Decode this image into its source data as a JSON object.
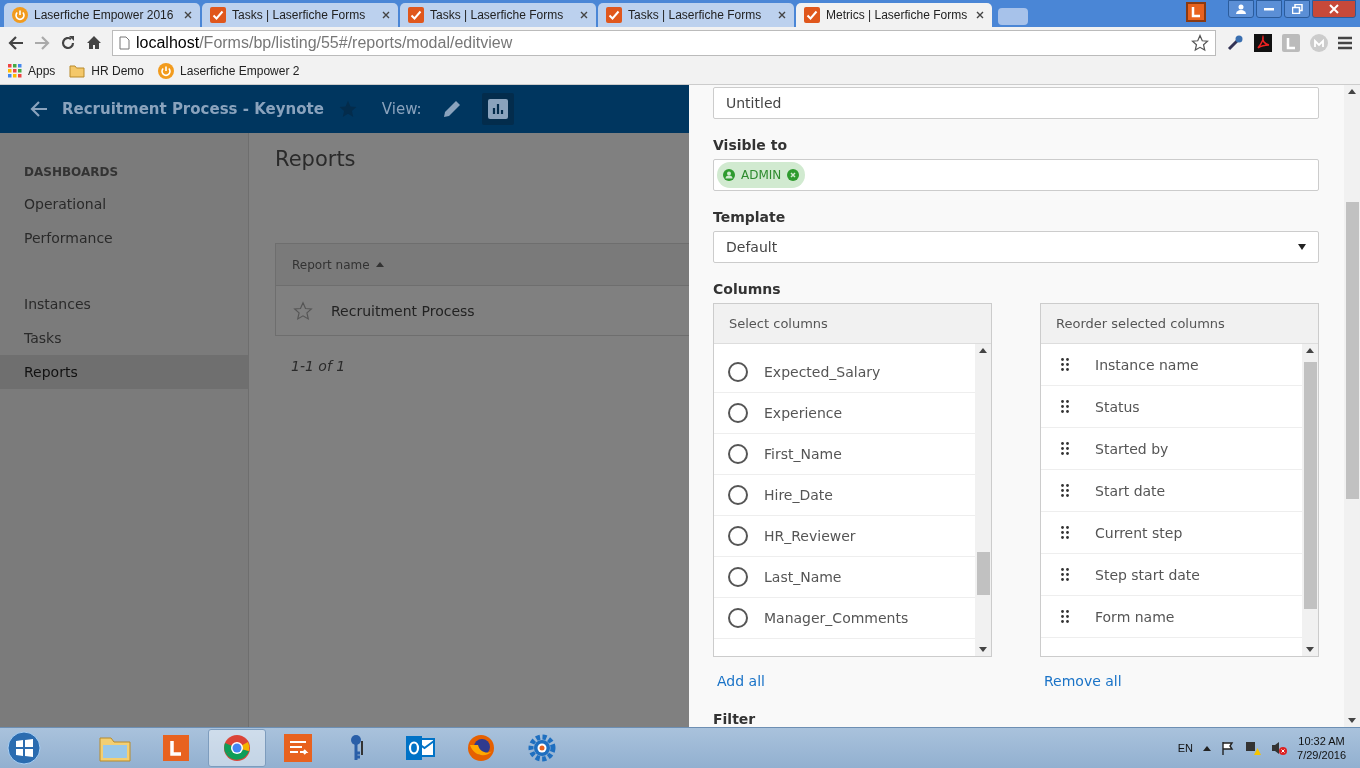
{
  "browser": {
    "tabs": [
      {
        "title": "Laserfiche Empower 2016",
        "kind": "power",
        "selected": false
      },
      {
        "title": "Tasks | Laserfiche Forms",
        "kind": "check",
        "selected": false
      },
      {
        "title": "Tasks | Laserfiche Forms",
        "kind": "check",
        "selected": false
      },
      {
        "title": "Tasks | Laserfiche Forms",
        "kind": "check",
        "selected": false
      },
      {
        "title": "Metrics | Laserfiche Forms",
        "kind": "check",
        "selected": true
      }
    ],
    "url": {
      "host": "localhost",
      "path": "/Forms/bp/listing/55#/reports/modal/editview"
    },
    "bookmarks": [
      {
        "label": "Apps",
        "kind": "apps"
      },
      {
        "label": "HR Demo",
        "kind": "folder"
      },
      {
        "label": "Laserfiche Empower 2",
        "kind": "power"
      }
    ]
  },
  "header": {
    "title": "Recruitment Process - Keynote",
    "view_label": "View:",
    "views": [
      {
        "kind": "edit",
        "selected": false
      },
      {
        "kind": "chart",
        "selected": true
      }
    ]
  },
  "sidebar": {
    "heading": "DASHBOARDS",
    "dashboards": [
      {
        "label": "Operational",
        "selected": false
      },
      {
        "label": "Performance",
        "selected": false
      }
    ],
    "items": [
      {
        "label": "Instances",
        "selected": false
      },
      {
        "label": "Tasks",
        "selected": false
      },
      {
        "label": "Reports",
        "selected": true
      }
    ]
  },
  "main": {
    "title": "Reports",
    "table": {
      "columns": [
        {
          "label": "Report name",
          "sorted_ascending": true
        }
      ],
      "rows": [
        {
          "name": "Recruitment Process",
          "starred": false
        }
      ]
    },
    "pagination": "1-1 of 1"
  },
  "modal": {
    "name_value": "Untitled",
    "visible_label": "Visible to",
    "visible_chips": [
      "ADMIN"
    ],
    "template_label": "Template",
    "template_value": "Default",
    "columns_label": "Columns",
    "available": {
      "header": "Select columns",
      "items": [
        {
          "label": "Expected_Salary",
          "checked": false
        },
        {
          "label": "Experience",
          "checked": false
        },
        {
          "label": "First_Name",
          "checked": false
        },
        {
          "label": "Hire_Date",
          "checked": false
        },
        {
          "label": "HR_Reviewer",
          "checked": false
        },
        {
          "label": "Last_Name",
          "checked": false
        },
        {
          "label": "Manager_Comments",
          "checked": false
        }
      ]
    },
    "selected": {
      "header": "Reorder selected columns",
      "items": [
        "Instance name",
        "Status",
        "Started by",
        "Start date",
        "Current step",
        "Step start date",
        "Form name"
      ]
    },
    "add_all": "Add all",
    "remove_all": "Remove all",
    "filter_label": "Filter"
  },
  "taskbar": {
    "apps": [
      {
        "kind": "explorer",
        "selected": false
      },
      {
        "kind": "laserfiche",
        "selected": false
      },
      {
        "kind": "chrome",
        "selected": true
      },
      {
        "kind": "forms",
        "selected": false
      },
      {
        "kind": "keys",
        "selected": false
      },
      {
        "kind": "outlook",
        "selected": false
      },
      {
        "kind": "firefox",
        "selected": false
      },
      {
        "kind": "settings",
        "selected": false
      }
    ],
    "language": "EN",
    "time": "10:32 AM",
    "date": "7/29/2016"
  }
}
